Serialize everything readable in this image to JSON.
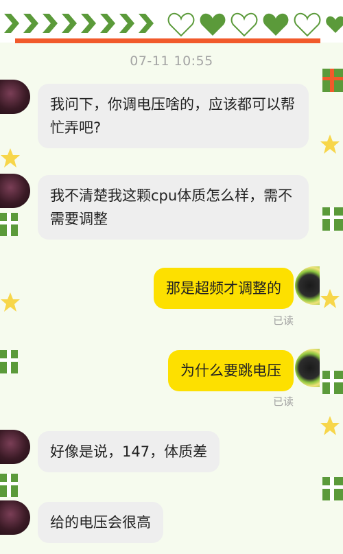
{
  "timestamp": "07-11 10:55",
  "messages": [
    {
      "side": "left",
      "text": "我问下，你调电压啥的，应该都可以帮忙弄吧?"
    },
    {
      "side": "left",
      "text": "我不清楚我这颗cpu体质怎么样，需不需要调整"
    },
    {
      "side": "right",
      "text": "那是超频才调整的",
      "status": "已读"
    },
    {
      "side": "right",
      "text": "为什么要跳电压",
      "status": "已读"
    },
    {
      "side": "left",
      "text": "好像是说，147，体质差"
    },
    {
      "side": "left",
      "text": "给的电压会很高"
    }
  ],
  "colors": {
    "incoming_bubble": "#eeeeee",
    "outgoing_bubble": "#fde000",
    "accent_bar": "#f15a2b",
    "decor_green": "#5b9a3a"
  },
  "icons": [
    "chevron-decor",
    "heart-decor",
    "gift-decor",
    "star-decor"
  ]
}
